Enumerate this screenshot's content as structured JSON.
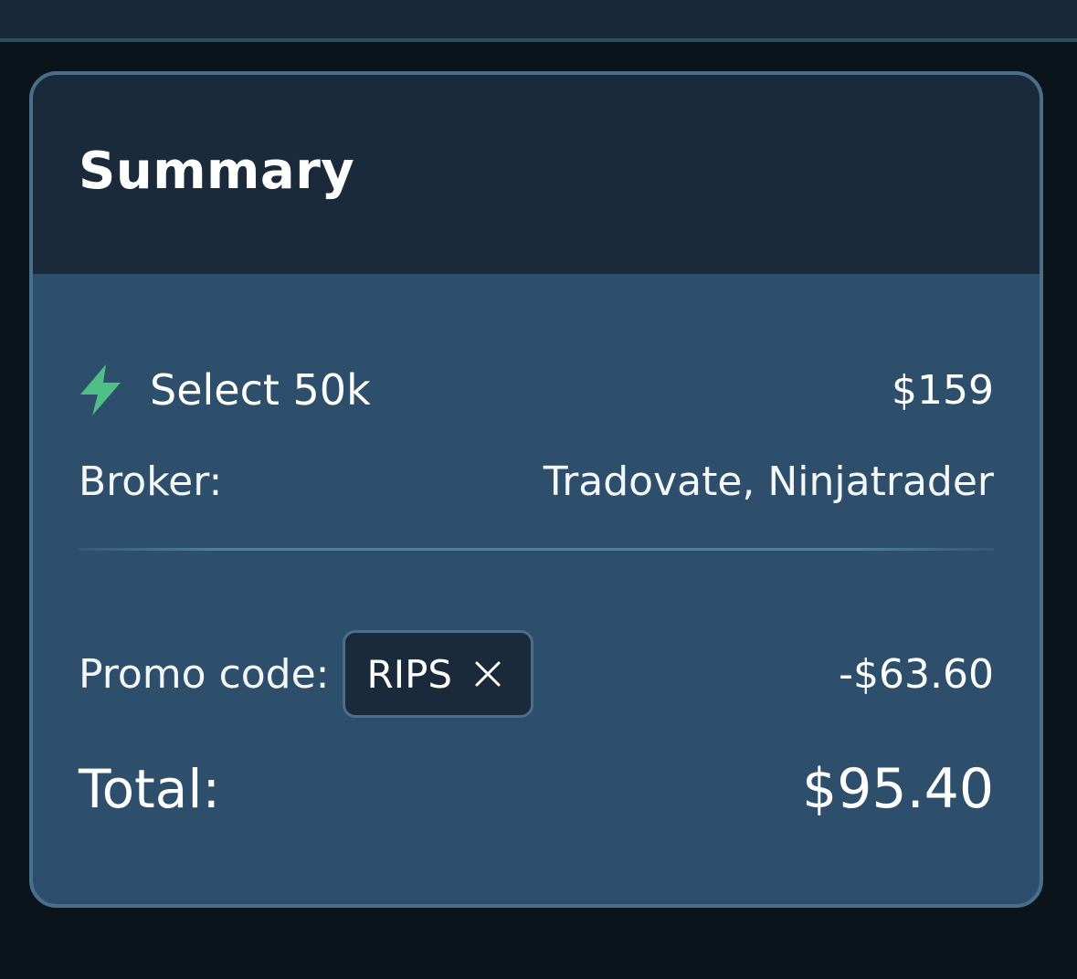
{
  "summary": {
    "title": "Summary",
    "product": {
      "icon": "lightning-bolt-icon",
      "name": "Select 50k",
      "price": "$159"
    },
    "broker": {
      "label": "Broker:",
      "value": "Tradovate, Ninjatrader"
    },
    "promo": {
      "label": "Promo code:",
      "code": "RIPS",
      "discount": "-$63.60"
    },
    "total": {
      "label": "Total:",
      "value": "$95.40"
    }
  },
  "colors": {
    "page_background": "#0b131b",
    "card_header": "#1b2a3a",
    "card_body": "#2d4f6b",
    "card_border": "#4a6f8d",
    "accent_bolt": "#4fbf86",
    "text": "#ffffff"
  }
}
